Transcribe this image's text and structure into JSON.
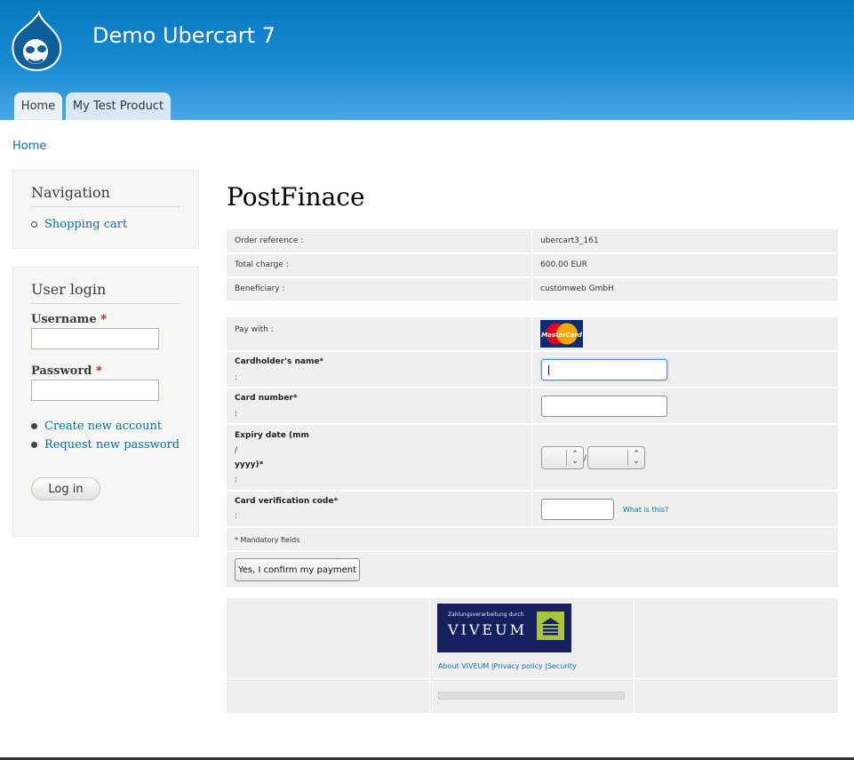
{
  "header": {
    "site_name": "Demo Ubercart 7",
    "tabs": [
      {
        "label": "Home"
      },
      {
        "label": "My Test Product"
      }
    ]
  },
  "breadcrumb": "Home",
  "sidebar": {
    "navigation": {
      "title": "Navigation",
      "items": [
        {
          "label": "Shopping cart"
        }
      ]
    },
    "user_login": {
      "title": "User login",
      "username_label": "Username",
      "password_label": "Password",
      "required_marker": "*",
      "links": [
        {
          "label": "Create new account"
        },
        {
          "label": "Request new password"
        }
      ],
      "login_button": "Log in"
    }
  },
  "main": {
    "title": "PostFinace",
    "summary": [
      {
        "label": "Order reference :",
        "value": "ubercart3_161"
      },
      {
        "label": "Total charge :",
        "value": "600.00 EUR"
      },
      {
        "label": "Beneficiary :",
        "value": "customweb GmbH"
      }
    ],
    "form": {
      "pay_with": "Pay with :",
      "cardholder_label": "Cardholder's name*",
      "card_number_label": "Card number*",
      "expiry_label_line1": "Expiry date (mm",
      "expiry_label_line2": "/",
      "expiry_label_line3": "yyyy)*",
      "cvc_label": "Card verification code*",
      "colon": ":",
      "expiry_separator": "/",
      "what_is_this": "What is this?",
      "mandatory_note": "* Mandatory fields",
      "confirm_button": "Yes, I confirm my payment",
      "card_logo_text": "MasterCard"
    },
    "footer": {
      "viveum_tagline": "Zahlungsverarbeitung durch",
      "viveum_brand": "VIVEUM",
      "links": "About VIVEUM |Privacy policy |Security"
    }
  },
  "colors": {
    "header_blue": "#0779bf",
    "link_blue": "#0071b3",
    "viveum_navy": "#16205f",
    "viveum_green": "#a7c63c"
  }
}
